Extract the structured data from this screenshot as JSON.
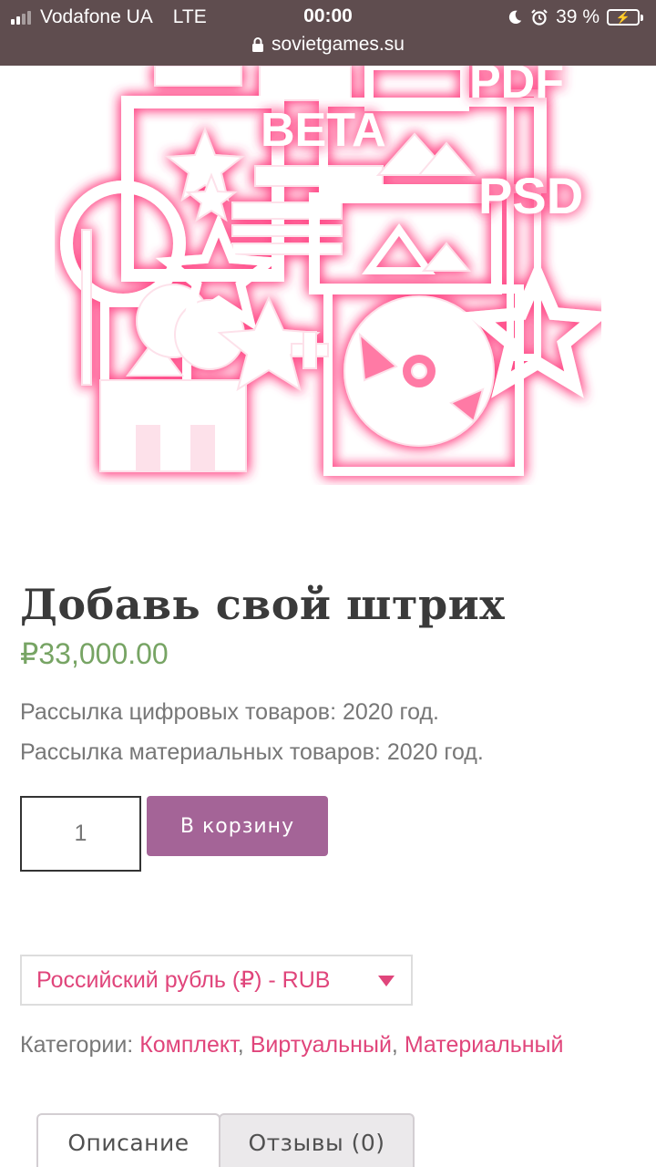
{
  "status_bar": {
    "carrier": "Vodafone UA",
    "network": "LTE",
    "time": "00:00",
    "battery": "39 %",
    "battery_level": 0.39,
    "url": "sovietgames.su"
  },
  "hero": {
    "image_text": [
      "BETA",
      "PSD",
      "PDF"
    ],
    "accent_color": "#ff4f8b"
  },
  "product": {
    "title": "Добавь свой штрих",
    "price": "₽33,000.00",
    "description": [
      "Рассылка цифровых товаров: 2020 год.",
      "Рассылка материальных товаров: 2020 год."
    ],
    "quantity": "1",
    "add_to_cart": "В корзину"
  },
  "currency": {
    "selected": "Российский рубль (₽) - RUB"
  },
  "categories": {
    "label": "Категории: ",
    "items": [
      "Комплект",
      "Виртуальный",
      "Материальный"
    ],
    "separator": ", "
  },
  "tabs": [
    {
      "label": "Описание",
      "active": true
    },
    {
      "label": "Отзывы (0)",
      "active": false
    }
  ],
  "colors": {
    "price": "#77a464",
    "button": "#a46497",
    "link": "#e0457b",
    "status_bar": "#5f4d4f"
  }
}
